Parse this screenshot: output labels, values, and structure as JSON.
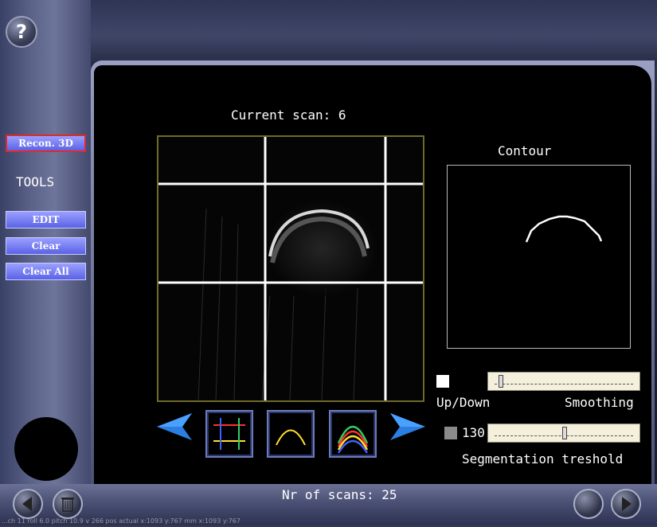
{
  "help": {
    "label": "?"
  },
  "sidebar": {
    "recon_label": "Recon. 3D",
    "tools_label": "TOOLS",
    "edit_label": "EDIT",
    "clear_label": "Clear",
    "clear_all_label": "Clear All"
  },
  "main": {
    "current_scan_label": "Current scan: 6",
    "nr_scans_label": "Nr of scans: 25",
    "contour_label": "Contour"
  },
  "controls": {
    "updown_label": "Up/Down",
    "smoothing_label": "Smoothing",
    "smoothing_value": 0.03,
    "threshold_value": "130",
    "threshold_fraction": 0.5,
    "segmentation_label": "Segmentation treshold"
  },
  "toolbar": {
    "prev_icon": "arrow-left-icon",
    "next_icon": "arrow-right-icon",
    "tools": [
      "grid-lines-icon",
      "single-curve-icon",
      "multi-curve-icon"
    ]
  },
  "footer": {
    "status_text": "...ch 11 roll 6.0 pitch 10.9 v 266 pos actual x:1093 y:767 mm x:1093 y:767",
    "back_icon": "back-arrow-icon",
    "trash_icon": "trash-icon",
    "forward_icon": "forward-arrow-icon"
  },
  "colors": {
    "accent": "#6a72f0",
    "arrow": "#2b7fe0"
  }
}
